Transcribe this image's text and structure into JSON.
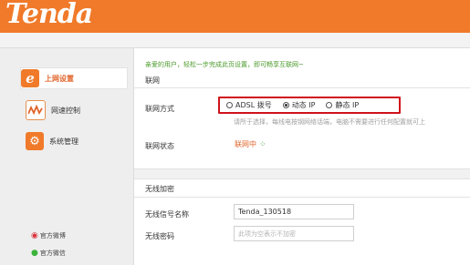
{
  "brand": {
    "logo": "Tenda"
  },
  "sidebar": {
    "items": [
      {
        "label": "上网设置",
        "icon": "internet-explorer-icon",
        "active": true
      },
      {
        "label": "网速控制",
        "icon": "speed-wave-icon",
        "active": false
      },
      {
        "label": "系统管理",
        "icon": "gear-icon",
        "active": false
      }
    ],
    "links": [
      {
        "label": "官方微博",
        "icon": "weibo-icon"
      },
      {
        "label": "官方微信",
        "icon": "wechat-icon"
      }
    ]
  },
  "main": {
    "welcome": "亲爱的用户，轻松一步完成此页设置，即可畅享互联网~",
    "internet_section": "联网",
    "connection_mode_label": "联网方式",
    "modes": [
      {
        "label": "ADSL 拨号",
        "selected": false
      },
      {
        "label": "动态 IP",
        "selected": true
      },
      {
        "label": "静态 IP",
        "selected": false
      }
    ],
    "hint": "请所于选择，每线电按钢网络话端，电脑不需要进行任何配置就可上",
    "status_label": "联网状态",
    "status_value": "联网中",
    "wireless_section": "无线加密",
    "ssid_label": "无线信号名称",
    "ssid_value": "Tenda_130518",
    "password_label": "无线密码",
    "password_placeholder": "此项为空表示不加密"
  },
  "colors": {
    "brand_orange": "#f07a2a",
    "highlight_red": "#d0121b",
    "status_orange": "#e0642a"
  }
}
